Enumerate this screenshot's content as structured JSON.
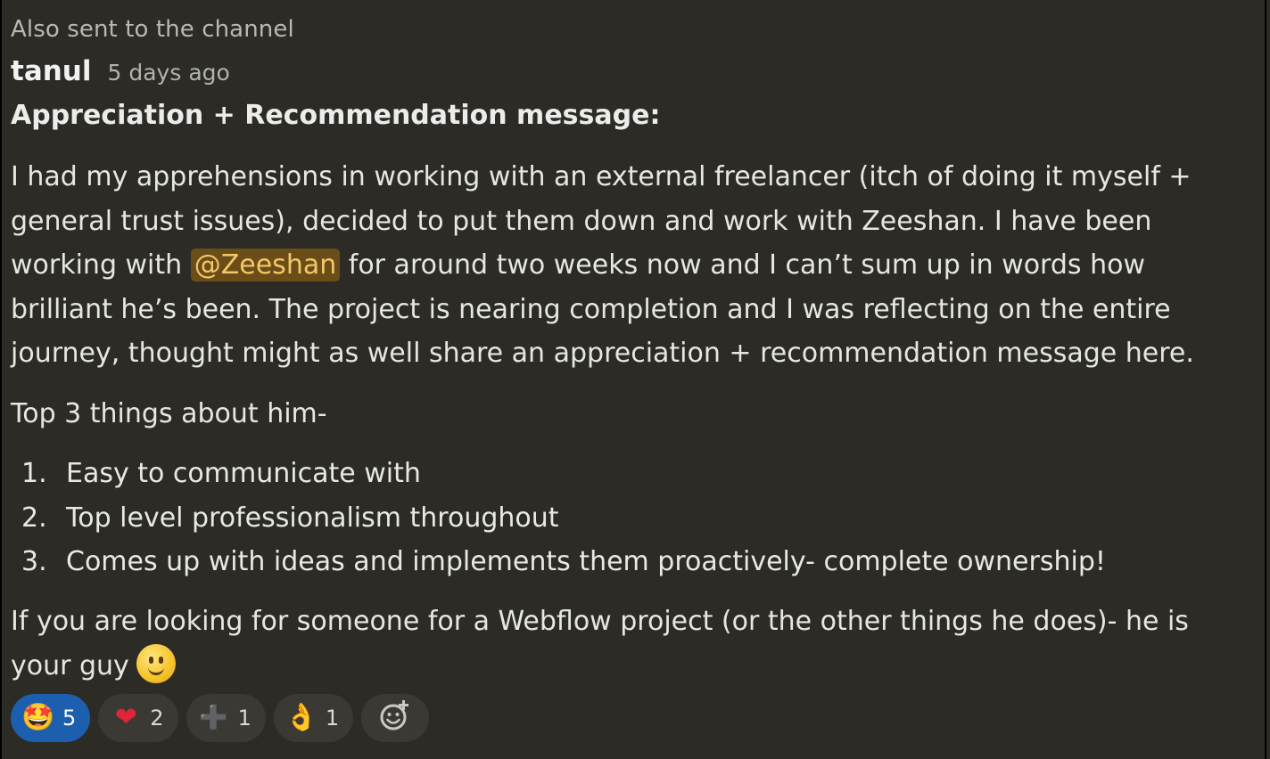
{
  "message": {
    "sent_note": "Also sent to the channel",
    "author": "tanul",
    "timestamp": "5 days ago",
    "title": "Appreciation + Recommendation message:",
    "p1_before_mention": "I had my apprehensions in working with an external freelancer (itch of doing it myself  + general trust issues), decided to put them down and work with Zeeshan. I have been working with ",
    "mention": "@Zeeshan",
    "p1_after_mention": " for around two weeks now and I can’t sum up in words how brilliant he’s been. The project is nearing completion and I was reflecting on the entire journey, thought might as well share an appreciation + recommendation message here.",
    "p2": "Top 3 things about him-",
    "list": [
      {
        "num": "1.",
        "text": "Easy to communicate with"
      },
      {
        "num": "2.",
        "text": "Top level professionalism throughout"
      },
      {
        "num": "3.",
        "text": "Comes up with ideas and implements them proactively- complete ownership!"
      }
    ],
    "p3": "If you are looking for someone for a Webflow project (or the other things he does)- he is your guy",
    "p3_icon": "slightly-smiling-face-icon"
  },
  "reactions": [
    {
      "icon": "star-struck-icon",
      "glyph": "🤩",
      "count": "5",
      "active": true
    },
    {
      "icon": "heart-icon",
      "glyph": "❤",
      "count": "2",
      "active": false
    },
    {
      "icon": "plus-icon",
      "glyph": "➕",
      "count": "1",
      "active": false
    },
    {
      "icon": "ok-hand-icon",
      "glyph": "👌",
      "count": "1",
      "active": false
    }
  ],
  "add_reaction_icon": "add-reaction-icon",
  "colors": {
    "background": "#2c2b26",
    "mention_bg": "#6b4e17",
    "mention_text": "#f3c66b",
    "active_reaction": "#1c5fae"
  }
}
